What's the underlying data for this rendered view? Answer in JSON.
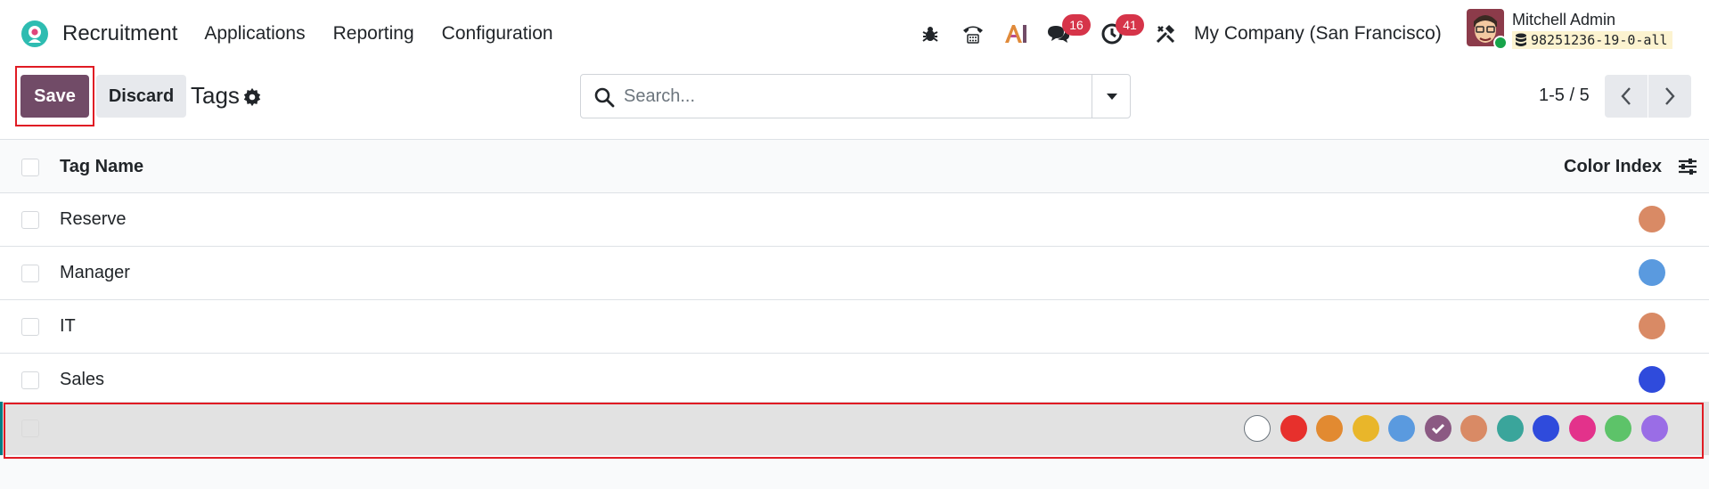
{
  "navbar": {
    "app_name": "Recruitment",
    "menu": [
      "Applications",
      "Reporting",
      "Configuration"
    ],
    "discuss_count": "16",
    "activity_count": "41",
    "company": "My Company (San Francisco)",
    "user_name": "Mitchell Admin",
    "database": "98251236-19-0-all",
    "brand_color": "#714b67"
  },
  "control": {
    "save_label": "Save",
    "discard_label": "Discard",
    "title": "Tags",
    "search_placeholder": "Search...",
    "pager": "1-5 / 5"
  },
  "list": {
    "columns": [
      "Tag Name",
      "Color Index"
    ],
    "rows": [
      {
        "name": "Reserve",
        "color": "#d98a65"
      },
      {
        "name": "Manager",
        "color": "#5a9adf"
      },
      {
        "name": "IT",
        "color": "#d98a65"
      },
      {
        "name": "Sales",
        "color": "#2f4bdc"
      }
    ],
    "edit_row": {
      "name": "",
      "palette": [
        "#ffffff",
        "#e7302c",
        "#e28a31",
        "#e9b62a",
        "#5a9adf",
        "#8b5a83",
        "#d98a65",
        "#3aa59b",
        "#2f4bdc",
        "#e3328b",
        "#5dc369",
        "#9a6de6"
      ],
      "selected_index": 5
    }
  }
}
